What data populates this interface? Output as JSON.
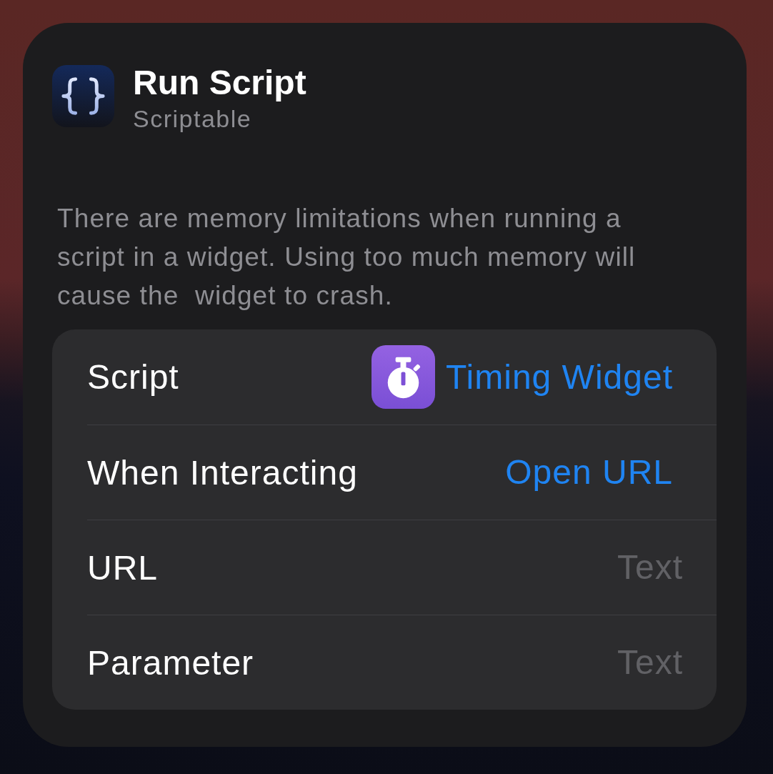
{
  "header": {
    "title": "Run Script",
    "subtitle": "Scriptable"
  },
  "description": "There are memory limitations when running a script in a widget. Using too much memory will cause the  widget to crash.",
  "parameters": [
    {
      "kind": "script",
      "label": "Script",
      "value": "Timing Widget"
    },
    {
      "kind": "menu",
      "label": "When Interacting",
      "value": "Open URL"
    },
    {
      "kind": "text",
      "label": "URL",
      "placeholder": "Text"
    },
    {
      "kind": "text",
      "label": "Parameter",
      "placeholder": "Text"
    }
  ]
}
